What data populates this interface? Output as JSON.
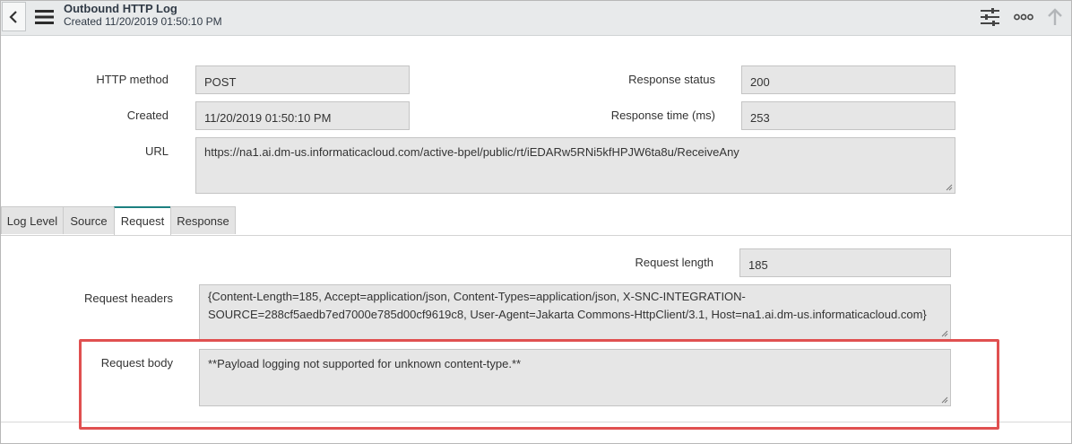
{
  "header": {
    "title": "Outbound HTTP Log",
    "subtitle": "Created 11/20/2019 01:50:10 PM"
  },
  "fields": {
    "http_method": {
      "label": "HTTP method",
      "value": "POST"
    },
    "created": {
      "label": "Created",
      "value": "11/20/2019 01:50:10 PM"
    },
    "url": {
      "label": "URL",
      "value": "https://na1.ai.dm-us.informaticacloud.com/active-bpel/public/rt/iEDARw5RNi5kfHPJW6ta8u/ReceiveAny"
    },
    "response_status": {
      "label": "Response status",
      "value": "200"
    },
    "response_time": {
      "label": "Response time (ms)",
      "value": "253"
    }
  },
  "tabs": [
    "Log Level",
    "Source",
    "Request",
    "Response"
  ],
  "active_tab": "Request",
  "request": {
    "length": {
      "label": "Request length",
      "value": "185"
    },
    "headers": {
      "label": "Request headers",
      "value": "{Content-Length=185, Accept=application/json, Content-Types=application/json, X-SNC-INTEGRATION-SOURCE=288cf5aedb7ed7000e785d00cf9619c8, User-Agent=Jakarta Commons-HttpClient/3.1, Host=na1.ai.dm-us.informaticacloud.com}"
    },
    "body": {
      "label": "Request body",
      "value": "**Payload logging not supported for unknown content-type.**"
    }
  },
  "colors": {
    "tab_accent": "#1d8080",
    "highlight": "#e05050",
    "field_bg": "#e6e6e6"
  },
  "icons": [
    "back-icon",
    "menu-icon",
    "settings-sliders-icon",
    "more-options-icon",
    "arrow-up-icon",
    "resize-grip-icon"
  ]
}
